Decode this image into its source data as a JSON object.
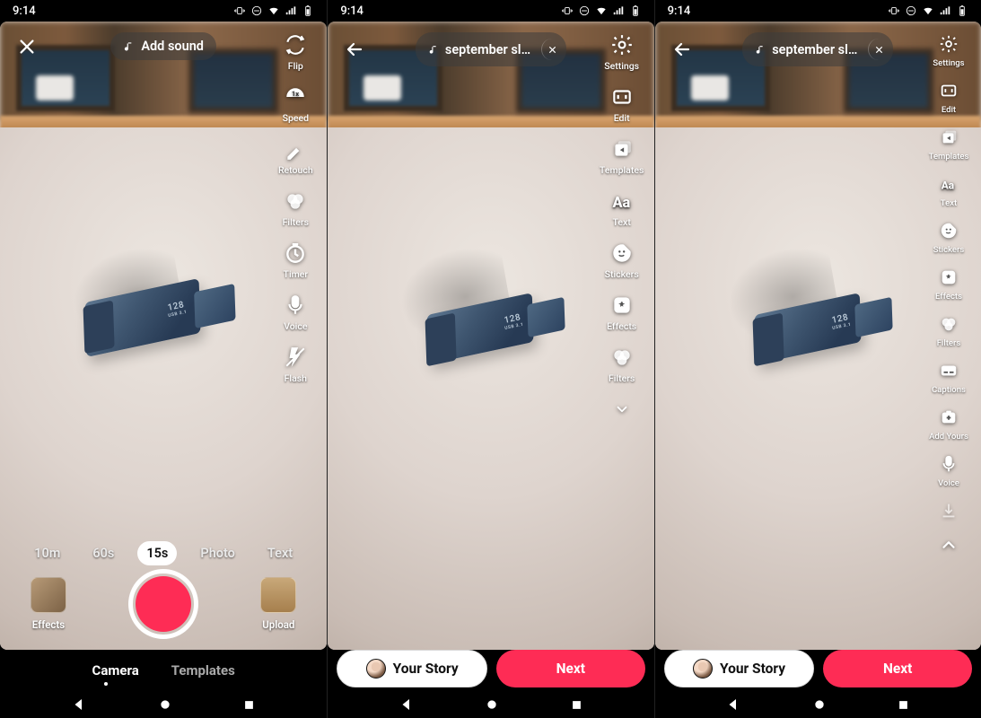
{
  "status": {
    "time": "9:14"
  },
  "screen1": {
    "sound_label": "Add sound",
    "tools": {
      "flip": "Flip",
      "speed": "Speed",
      "speed_badge": "1x",
      "retouch": "Retouch",
      "filters": "Filters",
      "timer": "Timer",
      "voice": "Voice",
      "flash": "Flash"
    },
    "durations": {
      "d10m": "10m",
      "d60s": "60s",
      "d15s": "15s",
      "photo": "Photo",
      "text": "Text"
    },
    "effects": "Effects",
    "upload": "Upload",
    "tabs": {
      "camera": "Camera",
      "templates": "Templates"
    }
  },
  "screen2": {
    "sound_label": "september sl…",
    "tools": {
      "settings": "Settings",
      "edit": "Edit",
      "templates": "Templates",
      "text": "Text",
      "stickers": "Stickers",
      "effects": "Effects",
      "filters": "Filters"
    },
    "story": "Your Story",
    "next": "Next"
  },
  "screen3": {
    "sound_label": "september sl…",
    "tools": {
      "settings": "Settings",
      "edit": "Edit",
      "templates": "Templates",
      "text": "Text",
      "stickers": "Stickers",
      "effects": "Effects",
      "filters": "Filters",
      "captions": "Captions",
      "addyours": "Add Yours",
      "voice": "Voice"
    },
    "story": "Your Story",
    "next": "Next"
  },
  "usb": {
    "label": "128",
    "sub": "USB 3.1"
  }
}
